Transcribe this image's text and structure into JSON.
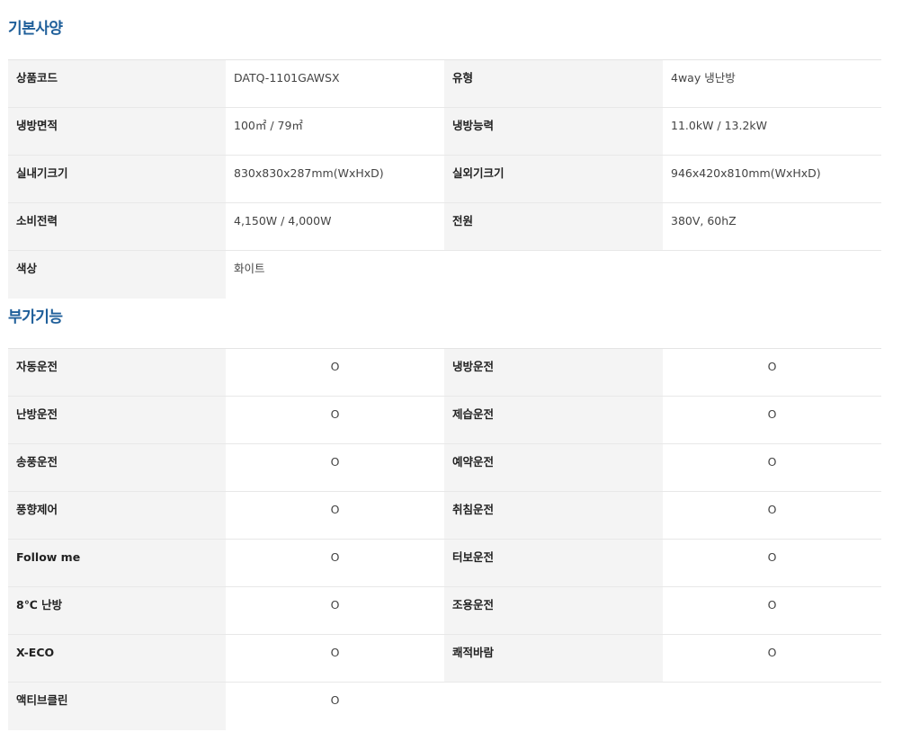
{
  "basic": {
    "title": "기본사양",
    "rows": [
      [
        {
          "label": "상품코드",
          "value": "DATQ-1101GAWSX"
        },
        {
          "label": "유형",
          "value": "4way 냉난방"
        }
      ],
      [
        {
          "label": "냉방면적",
          "value": "100㎡ / 79㎡"
        },
        {
          "label": "냉방능력",
          "value": "11.0kW / 13.2kW"
        }
      ],
      [
        {
          "label": "실내기크기",
          "value": "830x830x287mm(WxHxD)"
        },
        {
          "label": "실외기크기",
          "value": "946x420x810mm(WxHxD)"
        }
      ],
      [
        {
          "label": "소비전력",
          "value": "4,150W / 4,000W"
        },
        {
          "label": "전원",
          "value": "380V, 60hZ"
        }
      ],
      [
        {
          "label": "색상",
          "value": "화이트"
        }
      ]
    ]
  },
  "extra": {
    "title": "부가기능",
    "rows": [
      [
        {
          "label": "자동운전",
          "value": "O"
        },
        {
          "label": "냉방운전",
          "value": "O"
        }
      ],
      [
        {
          "label": "난방운전",
          "value": "O"
        },
        {
          "label": "제습운전",
          "value": "O"
        }
      ],
      [
        {
          "label": "송풍운전",
          "value": "O"
        },
        {
          "label": "예약운전",
          "value": "O"
        }
      ],
      [
        {
          "label": "풍향제어",
          "value": "O"
        },
        {
          "label": "취침운전",
          "value": "O"
        }
      ],
      [
        {
          "label": "Follow me",
          "value": "O"
        },
        {
          "label": "터보운전",
          "value": "O"
        }
      ],
      [
        {
          "label": "8℃ 난방",
          "value": "O"
        },
        {
          "label": "조용운전",
          "value": "O"
        }
      ],
      [
        {
          "label": "X-ECO",
          "value": "O"
        },
        {
          "label": "쾌적바람",
          "value": "O"
        }
      ],
      [
        {
          "label": "액티브클린",
          "value": "O"
        }
      ]
    ]
  }
}
